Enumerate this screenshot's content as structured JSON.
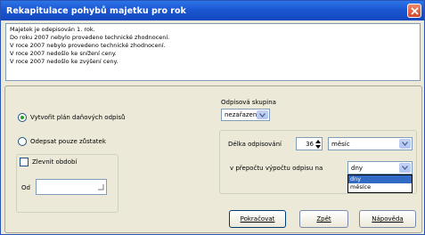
{
  "window": {
    "title": "Rekapitulace pohybů majetku pro rok"
  },
  "info_lines": [
    "Majetek je odepisován 1. rok.",
    "Do roku 2007 nebylo provedeno technické zhodnocení.",
    "V roce 2007 nebylo provedeno technické zhodnocení.",
    "V roce 2007 nedošlo ke snížení ceny.",
    "V roce 2007 nedošlo ke zvýšení ceny."
  ],
  "options": {
    "radio_plan": "Vytvořit plán daňových odpisů",
    "radio_remainder": "Odepsat pouze zůstatek",
    "checkbox_period": "Zlevnit období",
    "from_label": "Od"
  },
  "group": {
    "label": "Odpisová skupina",
    "value": "nezařazeno"
  },
  "duration": {
    "label": "Délka odpisování",
    "value": "36",
    "unit_value": "měsíc"
  },
  "conversion": {
    "label": "v přepočtu výpočtu odpisu na",
    "value": "dny",
    "options": [
      "dny",
      "měsíce"
    ]
  },
  "buttons": {
    "continue": "Pokračovat",
    "back": "Zpět",
    "help": "Nápověda"
  }
}
